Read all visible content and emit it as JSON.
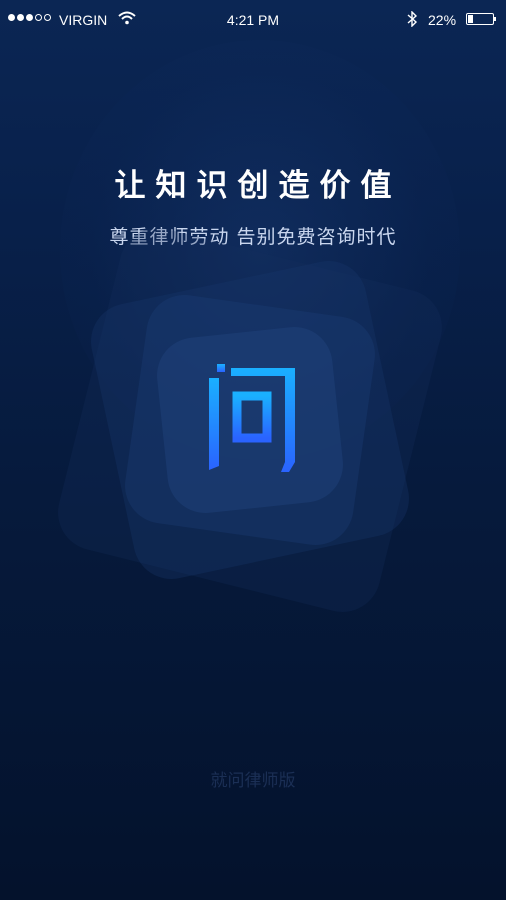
{
  "status_bar": {
    "carrier": "VIRGIN",
    "time": "4:21 PM",
    "battery_percent": "22%",
    "battery_level": 0.22,
    "signal_bars_filled": 3,
    "signal_bars_total": 5
  },
  "splash": {
    "headline": "让知识创造价值",
    "subtitle": "尊重律师劳动 告别免费咨询时代",
    "logo_char": "问",
    "footer": "就问律师版"
  },
  "colors": {
    "background_top": "#0b2654",
    "background_bottom": "#04122c",
    "logo_gradient_top": "#1ab0ff",
    "logo_gradient_bottom": "#2a63ff"
  }
}
